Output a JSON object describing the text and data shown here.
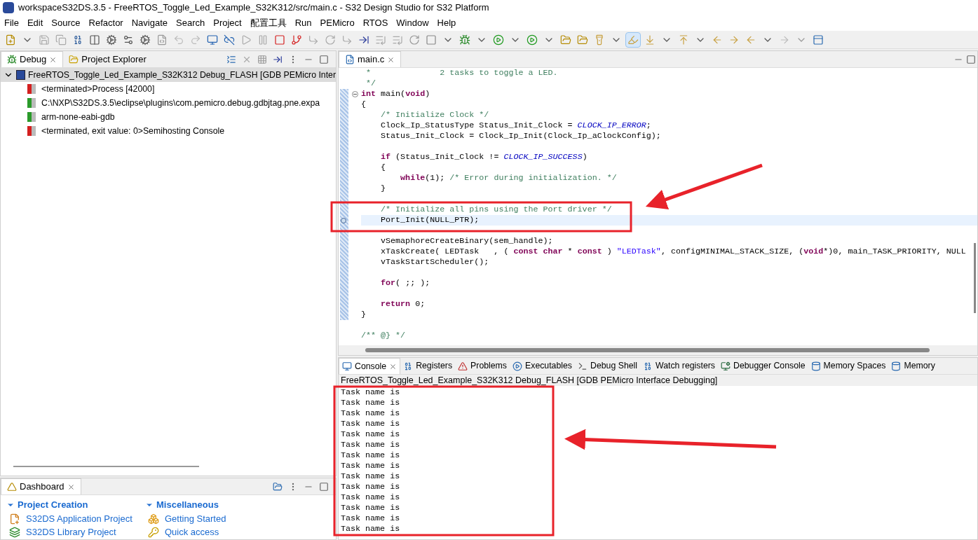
{
  "window": {
    "title": "workspaceS32DS.3.5 - FreeRTOS_Toggle_Led_Example_S32K312/src/main.c - S32 Design Studio for S32 Platform"
  },
  "menu": [
    "File",
    "Edit",
    "Source",
    "Refactor",
    "Navigate",
    "Search",
    "Project",
    "配置工具",
    "Run",
    "PEMicro",
    "RTOS",
    "Window",
    "Help"
  ],
  "debug_view": {
    "tabs": [
      {
        "label": "Debug",
        "selected": true
      },
      {
        "label": "Project Explorer",
        "selected": false
      }
    ],
    "tree": [
      {
        "label": "FreeRTOS_Toggle_Led_Example_S32K312 Debug_FLASH [GDB PEMicro Inter",
        "selected": true,
        "expanded": true,
        "children": [
          {
            "label": "<terminated>Process [42000]",
            "kind": "terminated"
          },
          {
            "label": "C:\\NXP\\S32DS.3.5\\eclipse\\plugins\\com.pemicro.debug.gdbjtag.pne.expa",
            "kind": "running"
          },
          {
            "label": "arm-none-eabi-gdb",
            "kind": "running"
          },
          {
            "label": "<terminated, exit value: 0>Semihosting Console",
            "kind": "terminated"
          }
        ]
      }
    ]
  },
  "dashboard": {
    "tab": "Dashboard",
    "sections": [
      {
        "title": "Project Creation",
        "items": [
          {
            "label": "S32DS Application Project",
            "kind": "new-project"
          },
          {
            "label": "S32DS Library Project",
            "kind": "library"
          }
        ]
      },
      {
        "title": "Miscellaneous",
        "items": [
          {
            "label": "Getting Started",
            "kind": "cubes"
          },
          {
            "label": "Quick access",
            "kind": "key"
          }
        ]
      }
    ]
  },
  "editor": {
    "tab": "main.c",
    "lines": [
      {
        "current": false,
        "tokens": [
          {
            "kind": "comment",
            "text": " *              2 tasks to toggle a LED."
          }
        ]
      },
      {
        "current": false,
        "tokens": [
          {
            "kind": "comment",
            "text": " */"
          }
        ]
      },
      {
        "current": false,
        "fold": true,
        "tokens": [
          {
            "kind": "keyword",
            "text": "int"
          },
          {
            "kind": "plain",
            "text": " main("
          },
          {
            "kind": "keyword",
            "text": "void"
          },
          {
            "kind": "plain",
            "text": ")"
          }
        ]
      },
      {
        "current": false,
        "tokens": [
          {
            "kind": "plain",
            "text": "{"
          }
        ]
      },
      {
        "current": false,
        "tokens": [
          {
            "kind": "comment",
            "text": "    /* Initialize Clock */"
          }
        ]
      },
      {
        "current": false,
        "tokens": [
          {
            "kind": "plain",
            "text": "    Clock_Ip_StatusType Status_Init_Clock = "
          },
          {
            "kind": "constant",
            "text": "CLOCK_IP_ERROR"
          },
          {
            "kind": "plain",
            "text": ";"
          }
        ]
      },
      {
        "current": false,
        "tokens": [
          {
            "kind": "plain",
            "text": "    Status_Init_Clock = Clock_Ip_Init(Clock_Ip_aClockConfig);"
          }
        ]
      },
      {
        "current": false
      },
      {
        "current": false,
        "tokens": [
          {
            "kind": "keyword",
            "text": "    if"
          },
          {
            "kind": "plain",
            "text": " (Status_Init_Clock != "
          },
          {
            "kind": "constant",
            "text": "CLOCK_IP_SUCCESS"
          },
          {
            "kind": "plain",
            "text": ")"
          }
        ]
      },
      {
        "current": false,
        "tokens": [
          {
            "kind": "plain",
            "text": "    {"
          }
        ]
      },
      {
        "current": false,
        "tokens": [
          {
            "kind": "keyword",
            "text": "        while"
          },
          {
            "kind": "plain",
            "text": "(1); "
          },
          {
            "kind": "comment",
            "text": "/* Error during initialization. */"
          }
        ]
      },
      {
        "current": false,
        "tokens": [
          {
            "kind": "plain",
            "text": "    }"
          }
        ]
      },
      {
        "current": false
      },
      {
        "current": false,
        "tokens": [
          {
            "kind": "comment",
            "text": "    /* Initialize all pins using the Port driver */"
          }
        ]
      },
      {
        "current": true,
        "tokens": [
          {
            "kind": "plain",
            "text": "    Port_Init(NULL_PTR);"
          }
        ]
      },
      {
        "current": false
      },
      {
        "current": false,
        "tokens": [
          {
            "kind": "plain",
            "text": "    vSemaphoreCreateBinary(sem_handle);"
          }
        ]
      },
      {
        "current": false,
        "tokens": [
          {
            "kind": "plain",
            "text": "    xTaskCreate( LEDTask   , ( "
          },
          {
            "kind": "keyword",
            "text": "const char"
          },
          {
            "kind": "plain",
            "text": " * "
          },
          {
            "kind": "keyword",
            "text": "const"
          },
          {
            "kind": "plain",
            "text": " ) "
          },
          {
            "kind": "string",
            "text": "\"LEDTask\""
          },
          {
            "kind": "plain",
            "text": ", configMINIMAL_STACK_SIZE, ("
          },
          {
            "kind": "keyword",
            "text": "void"
          },
          {
            "kind": "plain",
            "text": "*)0, main_TASK_PRIORITY, NULL"
          }
        ]
      },
      {
        "current": false,
        "tokens": [
          {
            "kind": "plain",
            "text": "    vTaskStartScheduler();"
          }
        ]
      },
      {
        "current": false
      },
      {
        "current": false,
        "tokens": [
          {
            "kind": "keyword",
            "text": "    for"
          },
          {
            "kind": "plain",
            "text": "( ;; );"
          }
        ]
      },
      {
        "current": false
      },
      {
        "current": false,
        "tokens": [
          {
            "kind": "keyword",
            "text": "    return"
          },
          {
            "kind": "plain",
            "text": " 0;"
          }
        ]
      },
      {
        "current": false,
        "tokens": [
          {
            "kind": "plain",
            "text": "}"
          }
        ]
      },
      {
        "current": false
      },
      {
        "current": false,
        "tokens": [
          {
            "kind": "comment",
            "text": "/** @} */"
          }
        ]
      }
    ]
  },
  "console": {
    "tabs": [
      {
        "label": "Console",
        "kind": "console",
        "selected": true
      },
      {
        "label": "Registers",
        "kind": "binary",
        "selected": false
      },
      {
        "label": "Problems",
        "kind": "problems",
        "selected": false
      },
      {
        "label": "Executables",
        "kind": "play",
        "selected": false
      },
      {
        "label": "Debug Shell",
        "kind": "shell",
        "selected": false
      },
      {
        "label": "Watch registers",
        "kind": "binary",
        "selected": false
      },
      {
        "label": "Debugger Console",
        "kind": "debugger",
        "selected": false
      },
      {
        "label": "Memory Spaces",
        "kind": "memory",
        "selected": false
      },
      {
        "label": "Memory",
        "kind": "memory",
        "selected": false
      }
    ],
    "title": "FreeRTOS_Toggle_Led_Example_S32K312 Debug_FLASH [GDB PEMicro Interface Debugging]",
    "lines": [
      "Task name is",
      "Task name is",
      "Task name is",
      "Task name is",
      "Task name is",
      "Task name is",
      "Task name is",
      "Task name is",
      "Task name is",
      "Task name is",
      "Task name is",
      "Task name is",
      "Task name is",
      "Task name is"
    ]
  }
}
